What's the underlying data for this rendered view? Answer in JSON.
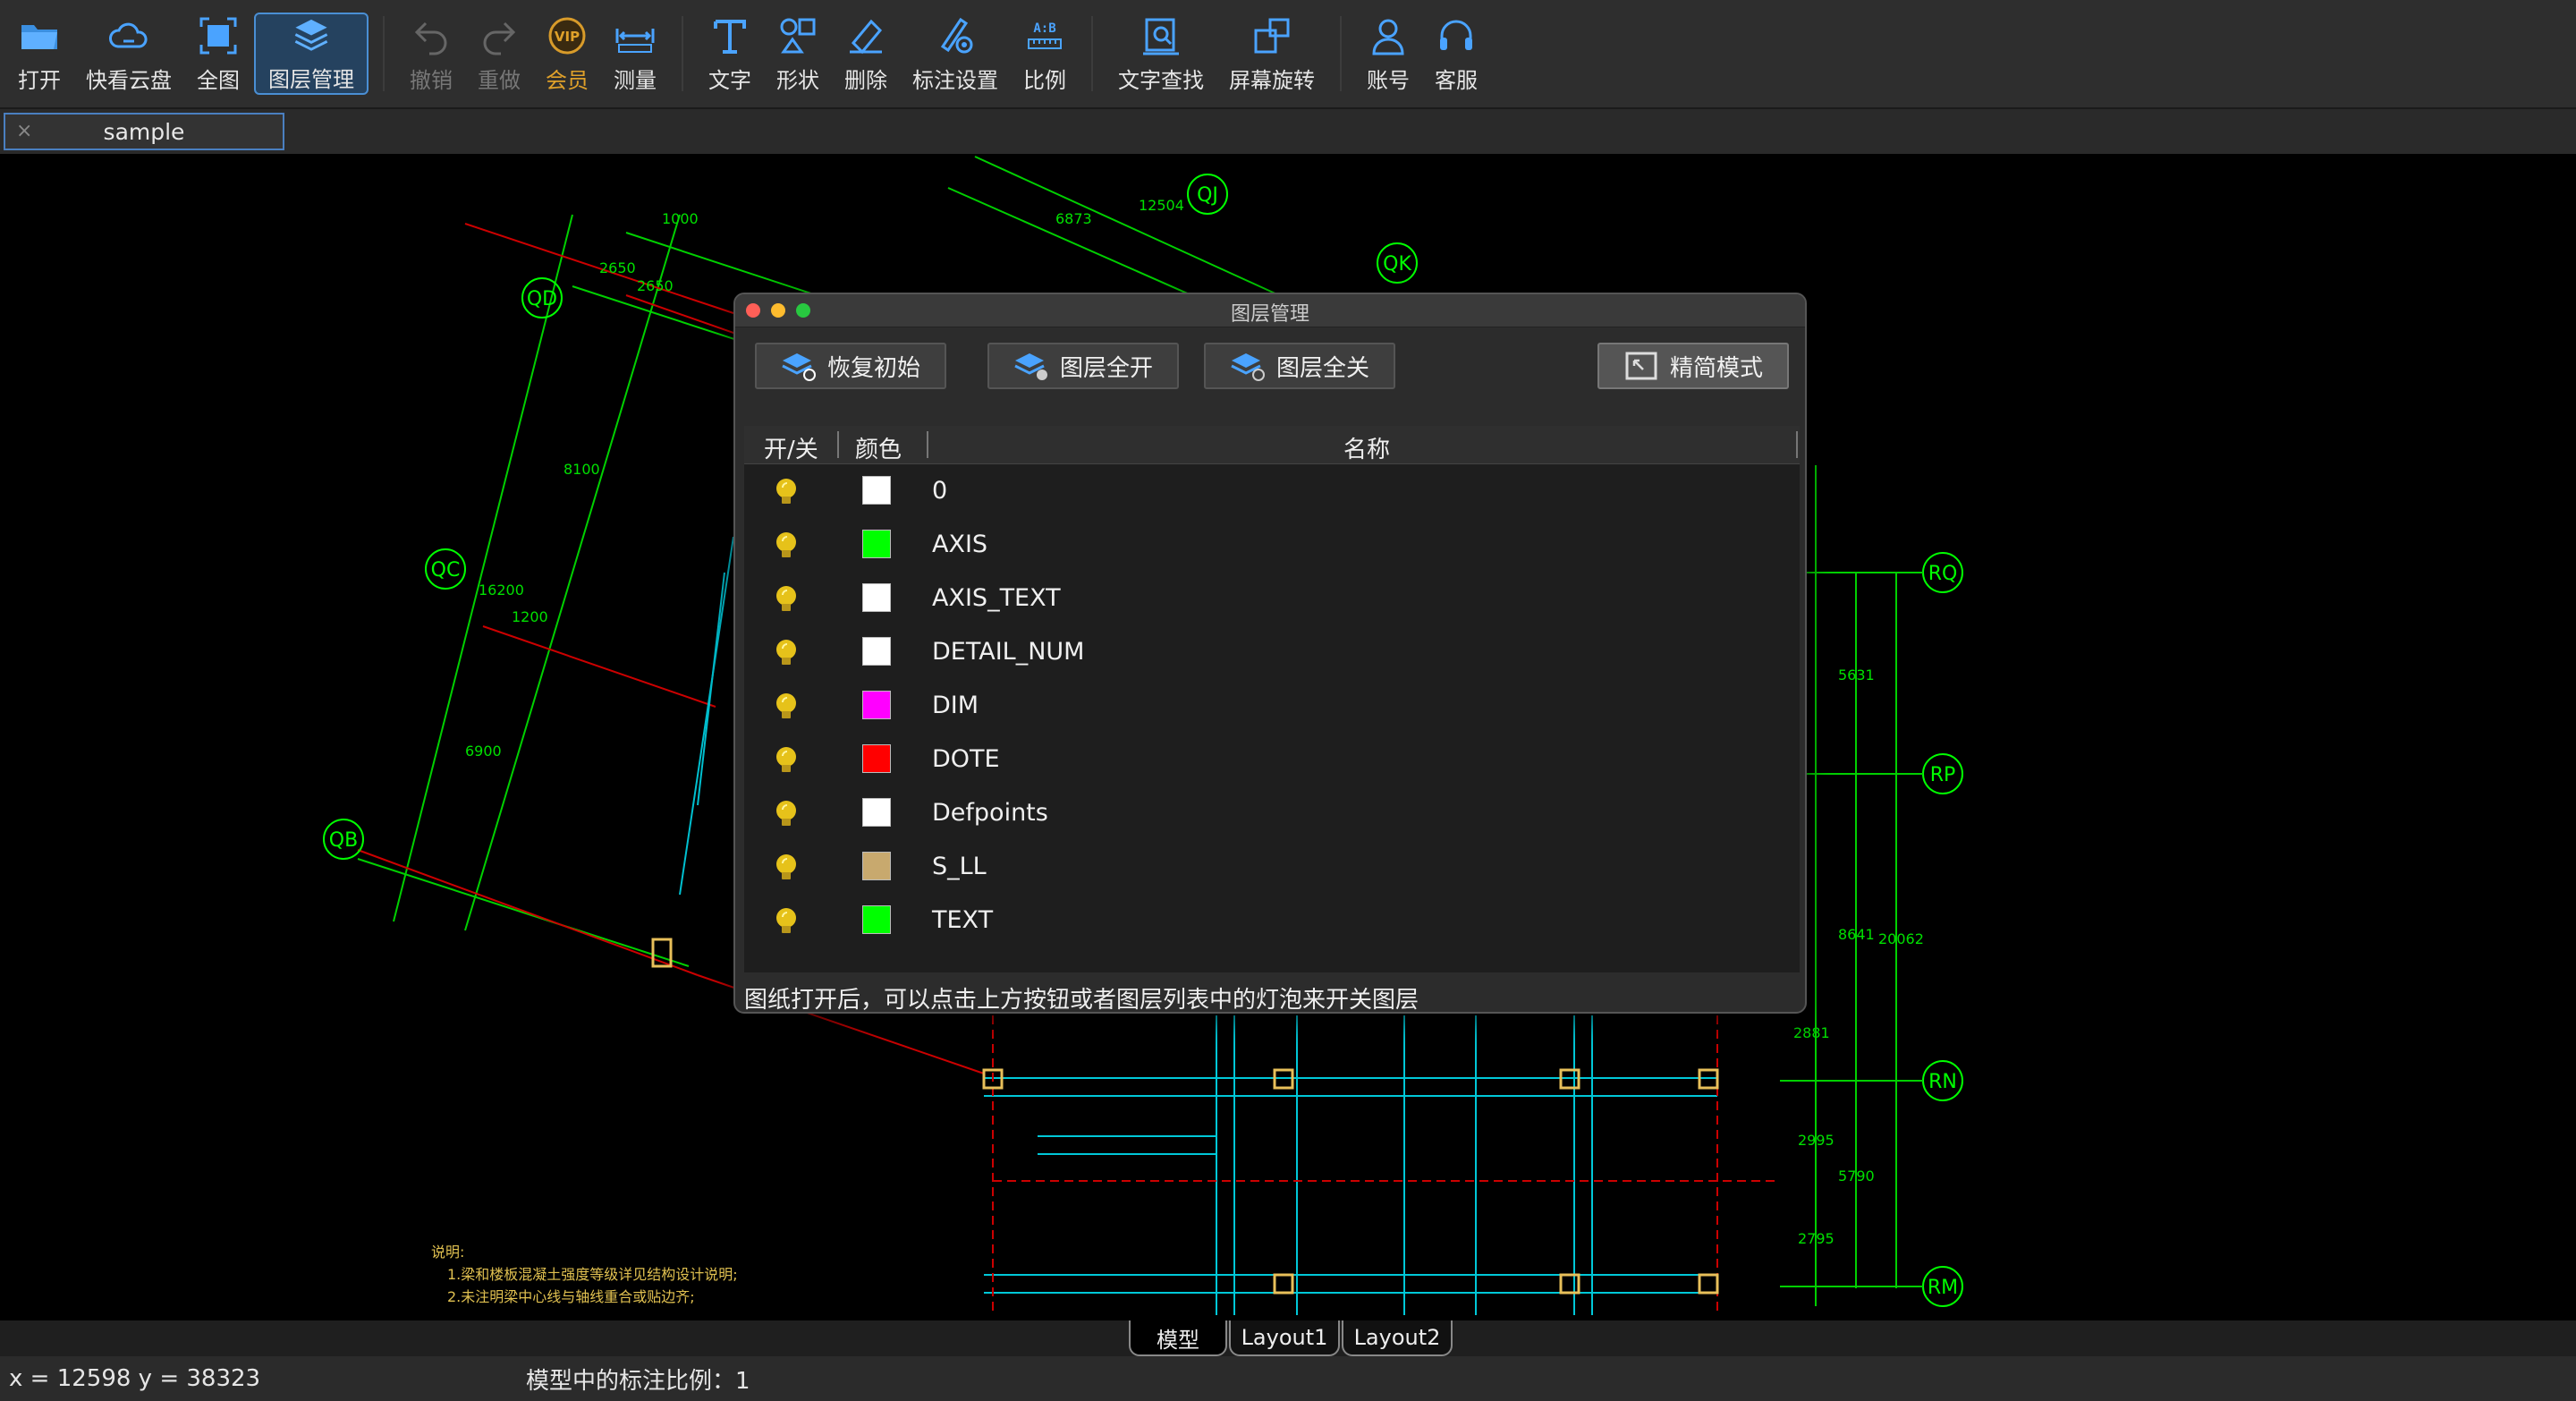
{
  "toolbar": {
    "items": [
      {
        "label": "打开",
        "icon": "folder-icon"
      },
      {
        "label": "快看云盘",
        "icon": "cloud-icon"
      },
      {
        "label": "全图",
        "icon": "fit-view-icon"
      },
      {
        "label": "图层管理",
        "icon": "layers-icon"
      },
      {
        "label": "撤销",
        "icon": "undo-icon"
      },
      {
        "label": "重做",
        "icon": "redo-icon"
      },
      {
        "label": "会员",
        "icon": "vip-icon"
      },
      {
        "label": "测量",
        "icon": "ruler-icon"
      },
      {
        "label": "文字",
        "icon": "text-icon"
      },
      {
        "label": "形状",
        "icon": "shape-icon"
      },
      {
        "label": "删除",
        "icon": "eraser-icon"
      },
      {
        "label": "标注设置",
        "icon": "annotation-settings-icon"
      },
      {
        "label": "比例",
        "icon": "scale-icon"
      },
      {
        "label": "文字查找",
        "icon": "text-search-icon"
      },
      {
        "label": "屏幕旋转",
        "icon": "rotate-screen-icon"
      },
      {
        "label": "账号",
        "icon": "user-icon"
      },
      {
        "label": "客服",
        "icon": "headset-icon"
      }
    ],
    "vip_badge": "VIP",
    "scale_badge": "A:B"
  },
  "document_tab": {
    "name": "sample",
    "close": "×"
  },
  "dialog": {
    "title": "图层管理",
    "buttons": {
      "restore": "恢复初始",
      "all_on": "图层全开",
      "all_off": "图层全关",
      "simple_mode": "精简模式"
    },
    "columns": {
      "toggle": "开/关",
      "color": "颜色",
      "name": "名称"
    },
    "layers": [
      {
        "name": "0",
        "color": "#ffffff",
        "on": true
      },
      {
        "name": "AXIS",
        "color": "#00ff00",
        "on": true
      },
      {
        "name": "AXIS_TEXT",
        "color": "#ffffff",
        "on": true
      },
      {
        "name": "DETAIL_NUM",
        "color": "#ffffff",
        "on": true
      },
      {
        "name": "DIM",
        "color": "#ff00ff",
        "on": true
      },
      {
        "name": "DOTE",
        "color": "#ff0000",
        "on": true
      },
      {
        "name": "Defpoints",
        "color": "#ffffff",
        "on": true
      },
      {
        "name": "S_LL",
        "color": "#c8a96e",
        "on": true
      },
      {
        "name": "TEXT",
        "color": "#00ff00",
        "on": true
      }
    ],
    "hint": "图纸打开后，可以点击上方按钮或者图层列表中的灯泡来开关图层"
  },
  "layout_tabs": [
    "模型",
    "Layout1",
    "Layout2"
  ],
  "status": {
    "coords": "x = 12598 y = 38323",
    "scale": "模型中的标注比例：1"
  },
  "drawing": {
    "axis_labels": [
      "QD",
      "QC",
      "QB",
      "QJ",
      "QK",
      "RQ",
      "RP",
      "RN",
      "RM"
    ],
    "dims": [
      "1000",
      "2650",
      "2650",
      "8100",
      "16200",
      "1200",
      "6900",
      "6873",
      "12504",
      "5631",
      "8641",
      "20062",
      "2881",
      "2995",
      "2795",
      "5790"
    ],
    "notes_title": "说明:",
    "notes": [
      "1.梁和楼板混凝土强度等级详见结构设计说明;",
      "2.未注明梁中心线与轴线重合或贴边齐;"
    ]
  }
}
